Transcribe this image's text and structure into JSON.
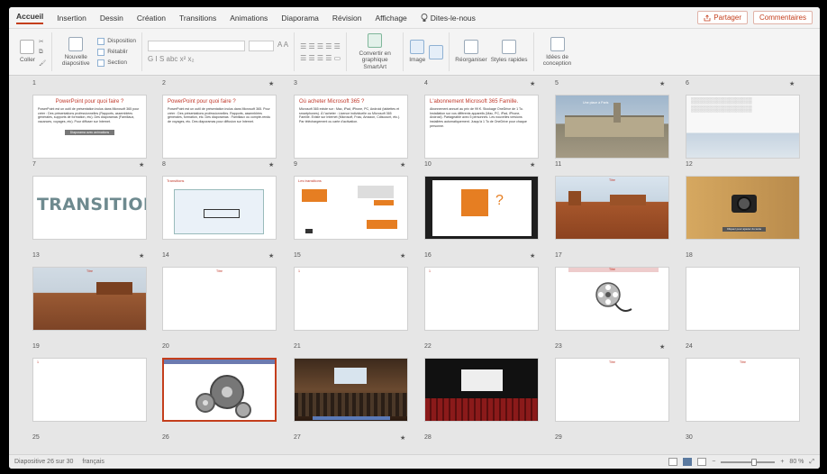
{
  "tabs": [
    "Accueil",
    "Insertion",
    "Dessin",
    "Création",
    "Transitions",
    "Animations",
    "Diaporama",
    "Révision",
    "Affichage"
  ],
  "tell_me": "Dites-le-nous",
  "share_label": "Partager",
  "comments_label": "Commentaires",
  "ribbon": {
    "paste": "Coller",
    "new_slide": "Nouvelle diapositive",
    "layout": "Disposition",
    "reset": "Rétablir",
    "section": "Section",
    "font_glyphs": "G I S abc x² x₂",
    "smartart": "Convertir en graphique SmartArt",
    "image": "Image",
    "arrange": "Réorganiser",
    "quick_styles": "Styles rapides",
    "design_ideas": "Idées de conception"
  },
  "slides": [
    {
      "num": "1",
      "star": false
    },
    {
      "num": "2",
      "star": true
    },
    {
      "num": "3",
      "star": false
    },
    {
      "num": "4",
      "star": true
    },
    {
      "num": "5",
      "star": true
    },
    {
      "num": "6",
      "star": true
    }
  ],
  "slide_titles": {
    "s1": "PowerPoint pour quoi faire ?",
    "s2": "PowerPoint pour quoi faire ?",
    "s3": "Où acheter Microsoft 365 ?",
    "s4": "L'abonnement Microsoft 365 Famille.",
    "s8": "Transitions",
    "s9": "Les transitions",
    "s11": "Titre",
    "s12": "Cliquez pour ajouter du texte",
    "s13": "Titre",
    "s14": "Titre",
    "s17": "Titre",
    "s23": "Titre",
    "s24": "Titre",
    "transitions_word": "TRANSITIONS",
    "s1_button": "Diaporama avec animations",
    "s5_caption": "Une place à Paris"
  },
  "slide_body": {
    "s1": "PowerPoint est un outil de présentation inclus dans Microsoft 365 pour créer : Des présentations professionnelles (Rapports, assemblées générales, supports de formation, etc). Des diaporamas (Familiaux, vacances, voyages, etc). Pour diffuser sur Internet.",
    "s2": "PowerPoint est un outil de présentation inclus dans Microsoft 365. Pour créer : Des présentations professionnelles. Rapports, assemblées générales, formation, etc. Des diaporamas : Familiaux ou compte-rendu de voyages, etc. Des diaporamas pour diffusion sur Internet.",
    "s3": "Microsoft 365 existe sur : Mac, iPad, iPhone, PC, Android (tablettes et smartphones). À l'acheter : Licence individuelle ou Microsoft 365 Famille. Existe sur Internet (Microsoft, Fnac, Amazon, Cdiscount, etc.). Par téléchargement ou carte d'activation.",
    "s4": "Abonnement annuel au prix de 99 €. Stockage OneDrive de 1 To. Installation sur vos différents appareils (Mac, PC, iPad, iPhone, Android). Partageable avec 5 personnes. Les nouvelles versions installées automatiquement. Jusqu'à 1 To de OneDrive pour chaque personne."
  },
  "row_numbers": [
    [
      "7",
      "8",
      "9",
      "10",
      "11",
      "12"
    ],
    [
      "13",
      "14",
      "15",
      "16",
      "17",
      "18"
    ],
    [
      "19",
      "20",
      "21",
      "22",
      "23",
      "24"
    ],
    [
      "25",
      "26",
      "27",
      "28",
      "29",
      "30"
    ]
  ],
  "row_stars": [
    [
      true,
      true,
      true,
      true,
      false,
      false
    ],
    [
      true,
      true,
      true,
      true,
      false,
      false
    ],
    [
      false,
      false,
      false,
      false,
      true,
      false
    ],
    [
      false,
      false,
      true,
      false,
      false,
      false
    ]
  ],
  "status": {
    "slide_info": "Diapositive 26 sur 30",
    "language": "français",
    "zoom": "80 %"
  },
  "colors": {
    "accent": "#c43e1c",
    "title_red": "#c0392b",
    "slide_orange": "#e67e22"
  }
}
